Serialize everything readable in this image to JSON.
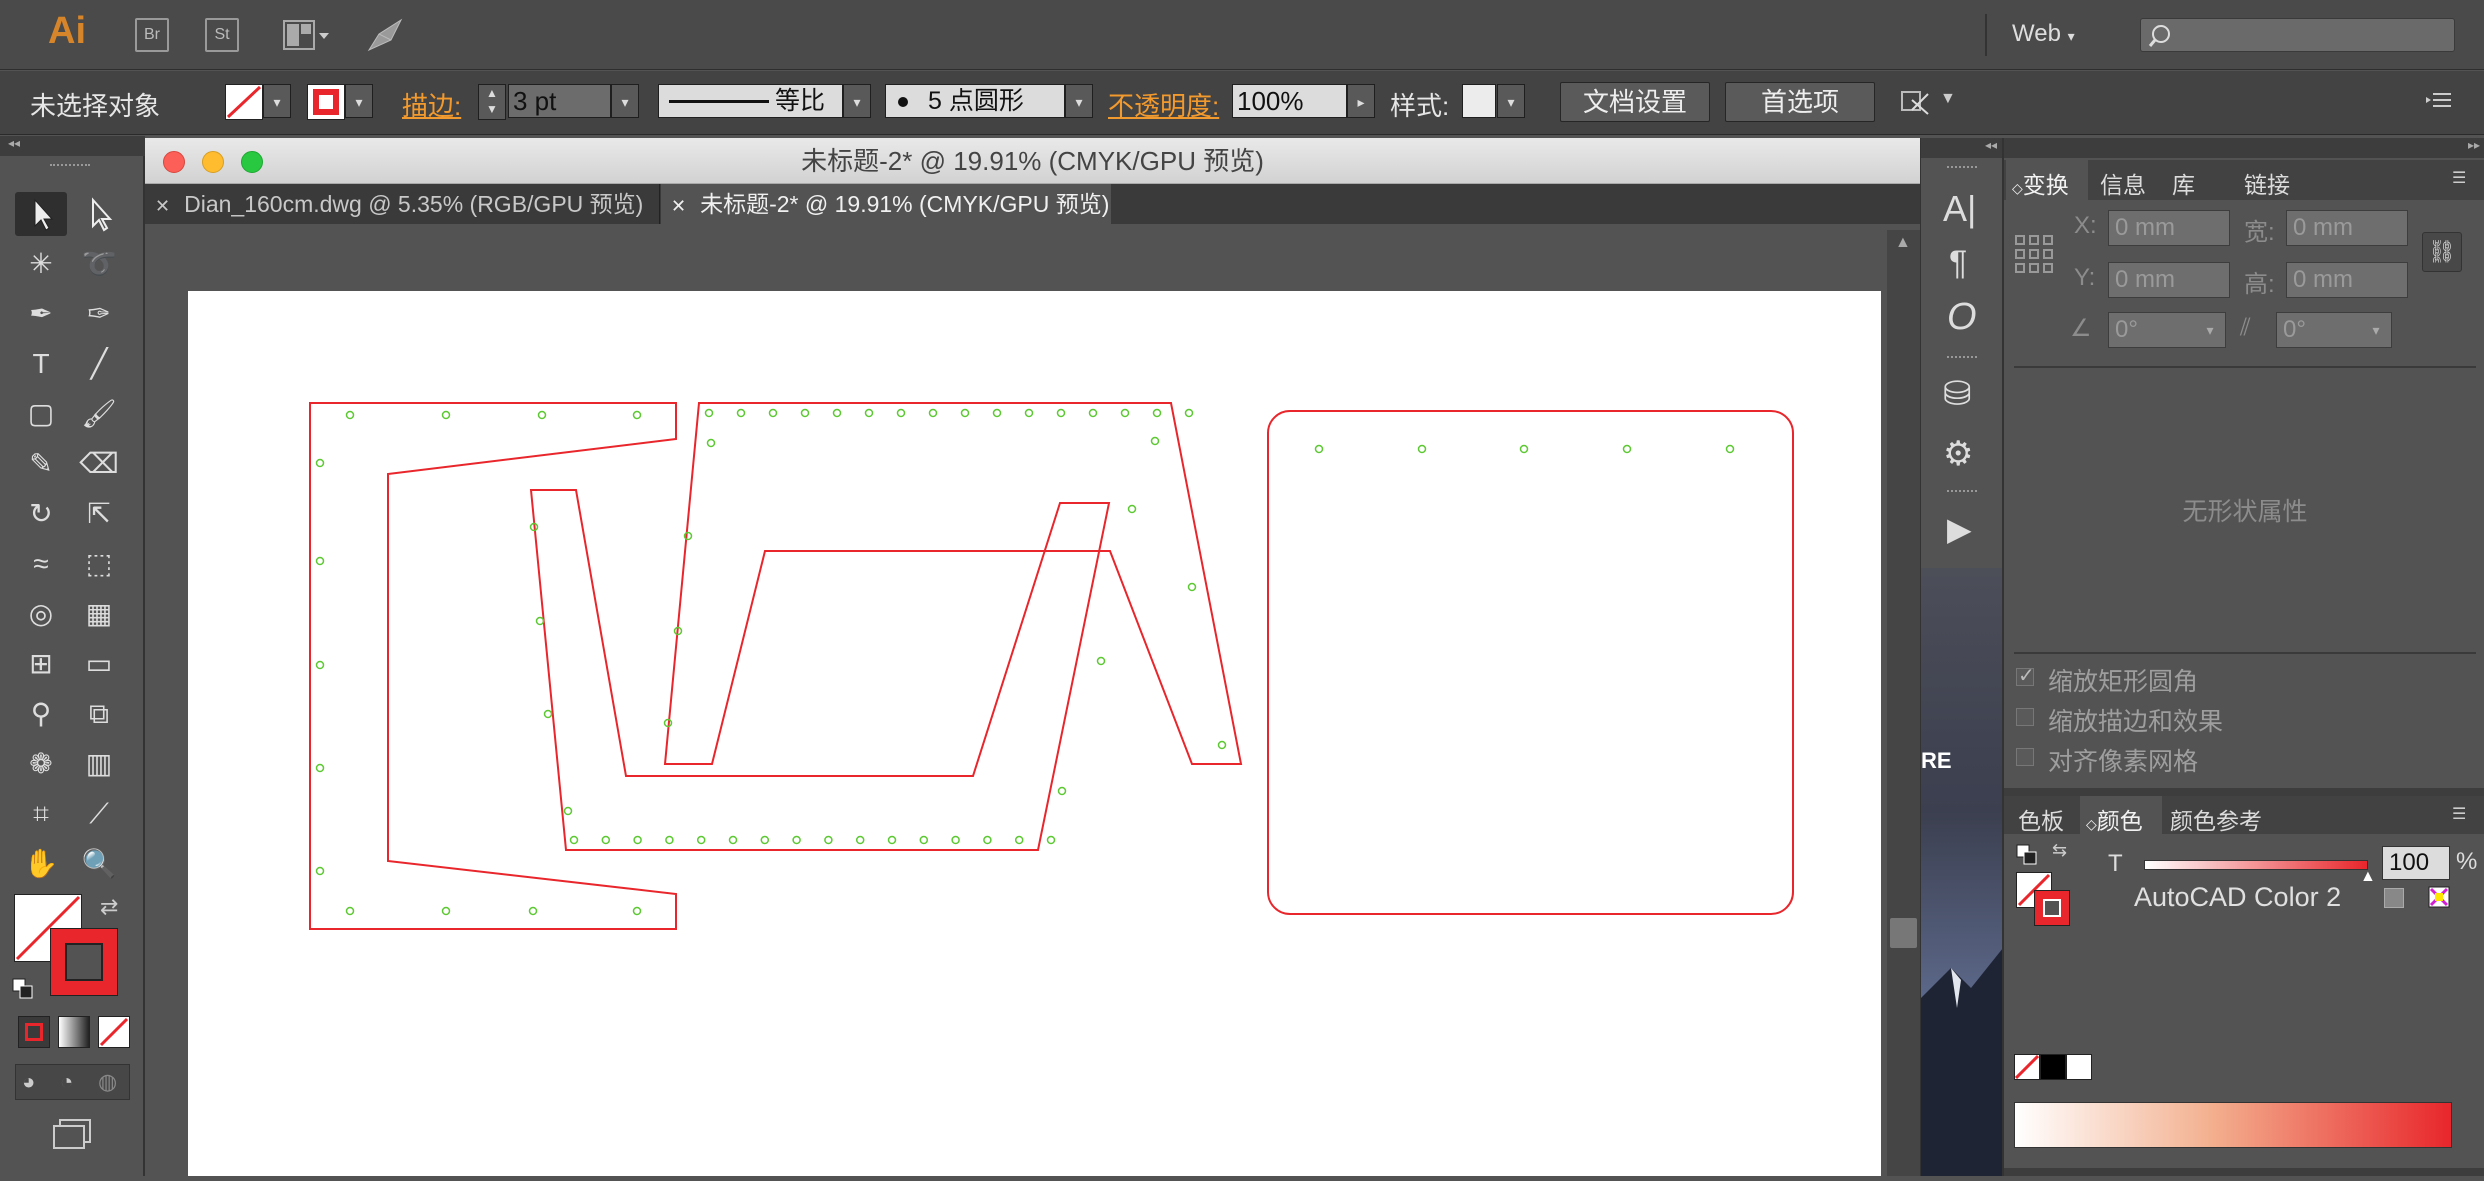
{
  "app": {
    "logo": "Ai",
    "bridge_label": "Br",
    "stock_label": "St",
    "workspace": "Web",
    "search_placeholder": ""
  },
  "control": {
    "selection_status": "未选择对象",
    "stroke_label": "描边:",
    "stroke_weight": "3 pt",
    "profile_label": "等比",
    "brush_label": "5 点圆形",
    "opacity_label": "不透明度:",
    "opacity_value": "100%",
    "style_label": "样式:",
    "doc_setup_button": "文档设置",
    "prefs_button": "首选项"
  },
  "document": {
    "window_title": "未标题-2* @ 19.91% (CMYK/GPU 预览)",
    "tabs": [
      {
        "label": "Dian_160cm.dwg @ 5.35% (RGB/GPU 预览)",
        "active": false
      },
      {
        "label": "未标题-2* @ 19.91% (CMYK/GPU 预览)",
        "active": true
      }
    ],
    "stroke_color": "#e8262b",
    "dot_color": "#5cc832"
  },
  "transform_panel": {
    "tabs": [
      "变换",
      "信息",
      "库",
      "链接"
    ],
    "x_label": "X:",
    "y_label": "Y:",
    "w_label": "宽:",
    "h_label": "高:",
    "x_value": "0 mm",
    "y_value": "0 mm",
    "w_value": "0 mm",
    "h_value": "0 mm",
    "angle_value": "0°",
    "shear_value": "0°",
    "no_shape_text": "无形状属性",
    "checkboxes": [
      {
        "label": "缩放矩形圆角",
        "checked": true
      },
      {
        "label": "缩放描边和效果",
        "checked": false
      },
      {
        "label": "对齐像素网格",
        "checked": false
      }
    ]
  },
  "color_panel": {
    "tabs": [
      "色板",
      "颜色",
      "颜色参考"
    ],
    "tint_label": "T",
    "tint_value": "100",
    "percent": "%",
    "color_name": "AutoCAD Color 2"
  },
  "side_partial_text": "RE"
}
